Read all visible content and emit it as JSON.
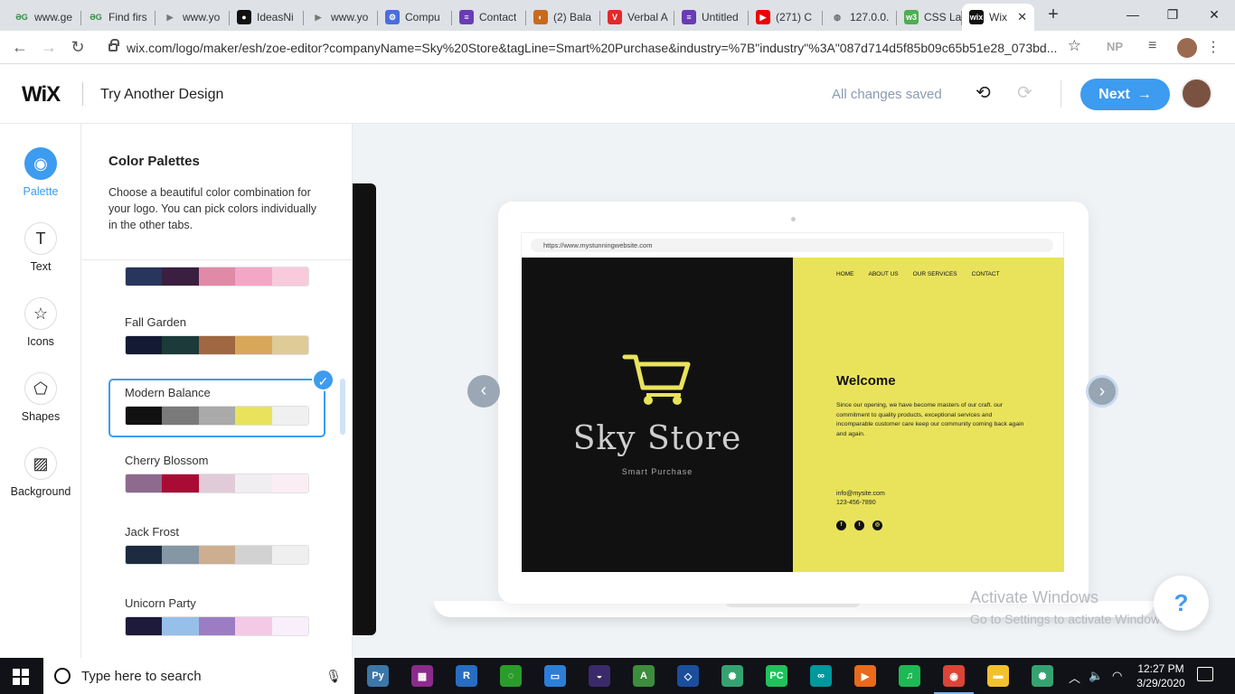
{
  "browser": {
    "tabs": [
      {
        "title": "www.ge",
        "icon": "gfg-icon",
        "color": "#2f8d46",
        "glyph": "ƏG"
      },
      {
        "title": "Find firs",
        "icon": "gfg-icon",
        "color": "#2f8d46",
        "glyph": "ƏG"
      },
      {
        "title": "www.yo",
        "icon": "video-icon",
        "color": "#777",
        "glyph": "▶"
      },
      {
        "title": "IdeasNi",
        "icon": "github-icon",
        "color": "#111",
        "glyph": "●"
      },
      {
        "title": "www.yo",
        "icon": "video-icon",
        "color": "#777",
        "glyph": "▶"
      },
      {
        "title": "Compu",
        "icon": "gear-icon",
        "color": "#4a6ee0",
        "glyph": "⚙"
      },
      {
        "title": "Contact",
        "icon": "form-icon",
        "color": "#6a3bb5",
        "glyph": "≡"
      },
      {
        "title": "(2) Bala",
        "icon": "loading-icon",
        "color": "#c96a1b",
        "glyph": "◐"
      },
      {
        "title": "Verbal A",
        "icon": "v-icon",
        "color": "#e12a2a",
        "glyph": "V"
      },
      {
        "title": "Untitled",
        "icon": "form-icon",
        "color": "#6a3bb5",
        "glyph": "≡"
      },
      {
        "title": "(271) C",
        "icon": "youtube-icon",
        "color": "#e00",
        "glyph": "▶"
      },
      {
        "title": "127.0.0.",
        "icon": "globe-icon",
        "color": "#666",
        "glyph": "◍"
      },
      {
        "title": "CSS Lay",
        "icon": "w3-icon",
        "color": "#4caf50",
        "glyph": "w3"
      },
      {
        "title": "Wix",
        "icon": "wix-icon",
        "color": "#111",
        "glyph": "wix"
      }
    ],
    "url": "wix.com/logo/maker/esh/zoe-editor?companyName=Sky%20Store&tagLine=Smart%20Purchase&industry=%7B\"industry\"%3A\"087d714d5f85b09c65b51e28_073bd...",
    "profile_initials": "NP"
  },
  "header": {
    "logo": "WiX",
    "try_another": "Try Another Design",
    "status": "All changes saved",
    "next_label": "Next",
    "next_arrow": "→",
    "undo_icon": "⟲",
    "redo_icon": "⟳"
  },
  "tools": [
    {
      "label": "Palette",
      "icon": "palette-icon",
      "glyph": "◉",
      "active": true
    },
    {
      "label": "Text",
      "icon": "text-icon",
      "glyph": "T",
      "active": false
    },
    {
      "label": "Icons",
      "icon": "star-icon",
      "glyph": "☆",
      "active": false
    },
    {
      "label": "Shapes",
      "icon": "shapes-icon",
      "glyph": "⬠",
      "active": false
    },
    {
      "label": "Background",
      "icon": "background-icon",
      "glyph": "▨",
      "active": false
    }
  ],
  "panel": {
    "title": "Color Palettes",
    "description": "Choose a beautiful color combination for your logo. You can pick colors individually in the other tabs.",
    "palettes": [
      {
        "name": "",
        "colors": [
          "#28355c",
          "#3a1f40",
          "#e08aa8",
          "#f4a6c6",
          "#f8cadb"
        ]
      },
      {
        "name": "Fall Garden",
        "colors": [
          "#141a33",
          "#1c3a3a",
          "#9f6742",
          "#d9a75a",
          "#dfcb98"
        ]
      },
      {
        "name": "Modern Balance",
        "colors": [
          "#111111",
          "#7a7a7a",
          "#aaaaaa",
          "#e9e35c",
          "#f0f0f0"
        ],
        "selected": true
      },
      {
        "name": "Cherry Blossom",
        "colors": [
          "#8e6b8e",
          "#aa0b34",
          "#e2cbd9",
          "#f0eef1",
          "#faeef4"
        ]
      },
      {
        "name": "Jack Frost",
        "colors": [
          "#1c2b40",
          "#8596a5",
          "#ceae90",
          "#d2d2d2",
          "#efefef"
        ]
      },
      {
        "name": "Unicorn Party",
        "colors": [
          "#1e1a3b",
          "#96c0ea",
          "#9c7dc4",
          "#f4c9e6",
          "#f9effb"
        ]
      }
    ]
  },
  "preview": {
    "url": "https://www.mystunningwebsite.com",
    "brand": "Sky Store",
    "tagline": "Smart Purchase",
    "nav": [
      "HOME",
      "ABOUT US",
      "OUR SERVICES",
      "CONTACT"
    ],
    "welcome": "Welcome",
    "welcome_text": "Since our opening, we have become masters of our craft. our commitment to quality products, exceptional services and incomparable customer care keep our community coming back again and again.",
    "email": "info@mysite.com",
    "phone": "123-456-7890",
    "social": [
      "f",
      "t",
      "◎"
    ],
    "accent": "#e9e35c",
    "prev_arrow": "‹",
    "next_arrow": "›"
  },
  "watermark": {
    "line1": "Activate Windows",
    "line2": "Go to Settings to activate Windows."
  },
  "help_label": "?",
  "taskbar": {
    "search_placeholder": "Type here to search",
    "apps": [
      {
        "name": "python-icon",
        "color": "#3b77a8",
        "glyph": "Py"
      },
      {
        "name": "winrar-icon",
        "color": "#8c2b8c",
        "glyph": "▦"
      },
      {
        "name": "r-icon",
        "color": "#276dc2",
        "glyph": "R"
      },
      {
        "name": "circle-app-icon",
        "color": "#2b9b2b",
        "glyph": "◌"
      },
      {
        "name": "display-icon",
        "color": "#2c7fd6",
        "glyph": "▭"
      },
      {
        "name": "eclipse-icon",
        "color": "#3b2a6b",
        "glyph": "◒"
      },
      {
        "name": "android-studio-icon",
        "color": "#3c8d3c",
        "glyph": "A"
      },
      {
        "name": "virtualbox-icon",
        "color": "#1b4f9c",
        "glyph": "◇"
      },
      {
        "name": "atom-icon",
        "color": "#35a371",
        "glyph": "✺"
      },
      {
        "name": "pycharm-icon",
        "color": "#21c15c",
        "glyph": "PC"
      },
      {
        "name": "arduino-icon",
        "color": "#00979d",
        "glyph": "∞"
      },
      {
        "name": "media-player-icon",
        "color": "#e86a1a",
        "glyph": "▶"
      },
      {
        "name": "spotify-icon",
        "color": "#1db954",
        "glyph": "♫"
      },
      {
        "name": "chrome-icon",
        "color": "#db4437",
        "glyph": "◉",
        "active": true
      },
      {
        "name": "file-explorer-icon",
        "color": "#f3c12d",
        "glyph": "▬"
      },
      {
        "name": "atom2-icon",
        "color": "#35a371",
        "glyph": "✺"
      }
    ],
    "time": "12:27 PM",
    "date": "3/29/2020"
  }
}
